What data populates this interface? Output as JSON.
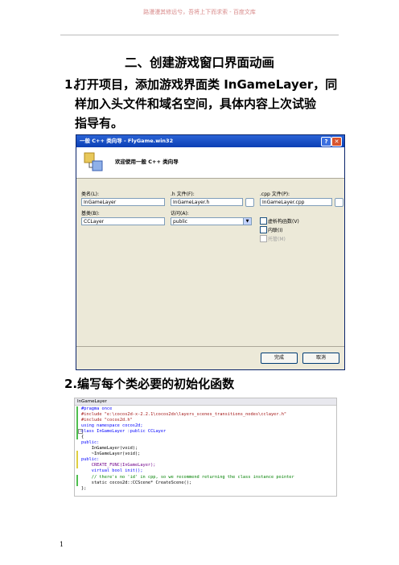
{
  "watermark": "路漫漫其修远兮，吾将上下而求索 - 百度文库",
  "heading": "二、创建游戏窗口界面动画",
  "step1": {
    "number": "1.",
    "line1": "打开项目，添加游戏界面类 InGameLayer，同",
    "line2": "样加入头文件和域名空间，具体内容上次试验",
    "line3": "指导有。"
  },
  "dialog": {
    "title": "一般 C++ 类向导 - FlyGame.win32",
    "help_button": "?",
    "close_button": "✕",
    "banner_text": "欢迎使用一般 C++ 类向导",
    "class_name_label": "类名(L):",
    "class_name_value": "InGameLayer",
    "h_file_label": ".h 文件(F):",
    "h_file_value": "InGameLayer.h",
    "cpp_file_label": ".cpp 文件(P):",
    "cpp_file_value": "InGameLayer.cpp",
    "base_class_label": "基类(B):",
    "base_class_value": "CCLayer",
    "access_label": "访问(A):",
    "access_value": "public",
    "checkbox_virtual": "虚析构函数(V)",
    "checkbox_inline": "内联(I)",
    "checkbox_managed": "托管(M)",
    "finish_button": "完成",
    "cancel_button": "取消"
  },
  "step2": {
    "number": "2.",
    "text": "编写每个类必要的初始化函数"
  },
  "code": {
    "tab": "InGameLayer",
    "lines": [
      "#pragma once",
      "#include \"e:\\cocos2d-x-2.2.1\\cocos2dx\\layers_scenes_transitions_nodes\\cclayer.h\"",
      "#include \"cocos2d.h\"",
      "using namespace cocos2d;",
      "class InGameLayer :public CCLayer",
      "{",
      "public:",
      "    InGameLayer(void);",
      "    ~InGameLayer(void);",
      "public:",
      "    CREATE_FUNC(InGameLayer);",
      "    virtual bool init();",
      "    // there's no 'id' in cpp, so we recommend returning the class instance pointer",
      "    static cocos2d::CCScene* CreateScene();",
      "};"
    ]
  },
  "page_number": "1"
}
